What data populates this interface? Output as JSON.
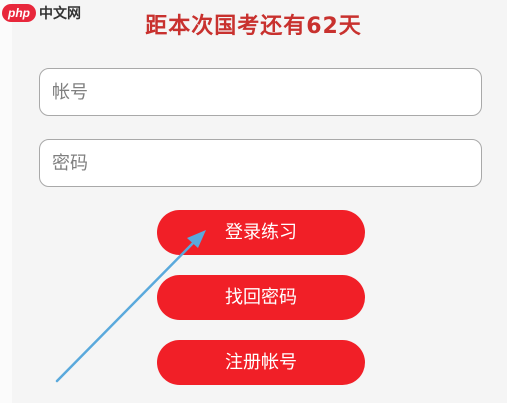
{
  "watermark": {
    "logo_text": "php",
    "site_text": "中文网"
  },
  "header": {
    "countdown": "距本次国考还有62天"
  },
  "form": {
    "account_placeholder": "帐号",
    "password_placeholder": "密码"
  },
  "buttons": {
    "login_label": "登录练习",
    "forgot_label": "找回密码",
    "register_label": "注册帐号"
  },
  "colors": {
    "accent": "#f11f27",
    "title": "#c8312e",
    "annotation_arrow": "#4ea3d9"
  }
}
